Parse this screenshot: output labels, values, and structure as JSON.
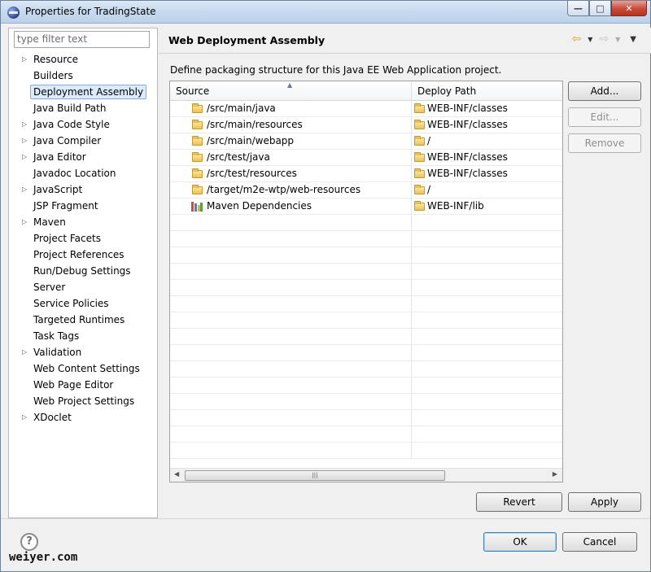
{
  "window": {
    "title": "Properties for TradingState"
  },
  "left": {
    "filter_placeholder": "type filter text",
    "items": [
      {
        "label": "Resource",
        "expandable": true
      },
      {
        "label": "Builders",
        "expandable": false
      },
      {
        "label": "Deployment Assembly",
        "expandable": false,
        "selected": true
      },
      {
        "label": "Java Build Path",
        "expandable": false
      },
      {
        "label": "Java Code Style",
        "expandable": true
      },
      {
        "label": "Java Compiler",
        "expandable": true
      },
      {
        "label": "Java Editor",
        "expandable": true
      },
      {
        "label": "Javadoc Location",
        "expandable": false
      },
      {
        "label": "JavaScript",
        "expandable": true
      },
      {
        "label": "JSP Fragment",
        "expandable": false
      },
      {
        "label": "Maven",
        "expandable": true
      },
      {
        "label": "Project Facets",
        "expandable": false
      },
      {
        "label": "Project References",
        "expandable": false
      },
      {
        "label": "Run/Debug Settings",
        "expandable": false
      },
      {
        "label": "Server",
        "expandable": false
      },
      {
        "label": "Service Policies",
        "expandable": false
      },
      {
        "label": "Targeted Runtimes",
        "expandable": false
      },
      {
        "label": "Task Tags",
        "expandable": false
      },
      {
        "label": "Validation",
        "expandable": true
      },
      {
        "label": "Web Content Settings",
        "expandable": false
      },
      {
        "label": "Web Page Editor",
        "expandable": false
      },
      {
        "label": "Web Project Settings",
        "expandable": false
      },
      {
        "label": "XDoclet",
        "expandable": true
      }
    ]
  },
  "main": {
    "title": "Web Deployment Assembly",
    "description": "Define packaging structure for this Java EE Web Application project.",
    "table": {
      "headers": [
        "Source",
        "Deploy Path"
      ],
      "rows": [
        {
          "source": "/src/main/java",
          "deploy": "WEB-INF/classes",
          "icon": "folder-icon"
        },
        {
          "source": "/src/main/resources",
          "deploy": "WEB-INF/classes",
          "icon": "folder-icon"
        },
        {
          "source": "/src/main/webapp",
          "deploy": "/",
          "icon": "folder-icon"
        },
        {
          "source": "/src/test/java",
          "deploy": "WEB-INF/classes",
          "icon": "folder-icon"
        },
        {
          "source": "/src/test/resources",
          "deploy": "WEB-INF/classes",
          "icon": "folder-icon"
        },
        {
          "source": "/target/m2e-wtp/web-resources",
          "deploy": "/",
          "icon": "folder-icon"
        },
        {
          "source": "Maven Dependencies",
          "deploy": "WEB-INF/lib",
          "icon": "library-icon"
        }
      ]
    },
    "buttons": {
      "add": "Add...",
      "edit": "Edit...",
      "remove": "Remove",
      "revert": "Revert",
      "apply": "Apply"
    }
  },
  "footer": {
    "ok": "OK",
    "cancel": "Cancel",
    "watermark": "weiyer.com"
  }
}
